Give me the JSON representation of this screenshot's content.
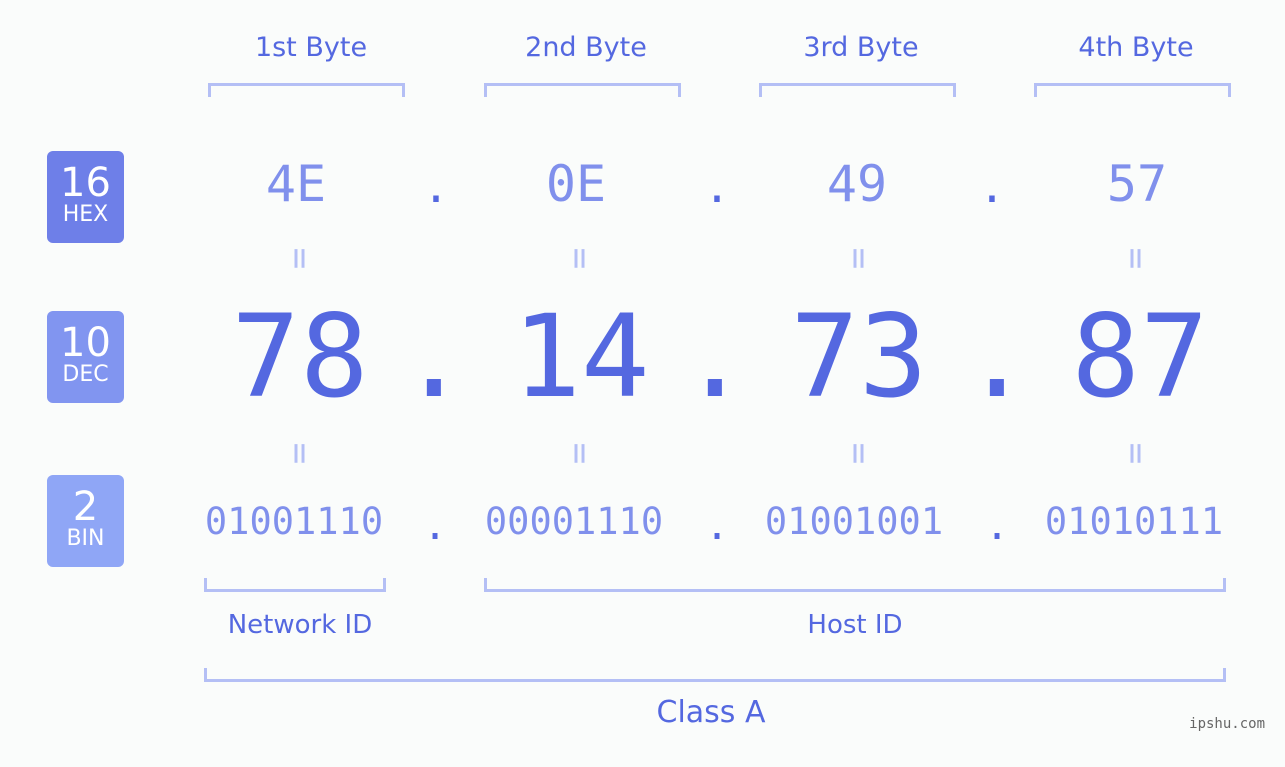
{
  "badges": [
    {
      "number": "16",
      "label": "HEX"
    },
    {
      "number": "10",
      "label": "DEC"
    },
    {
      "number": "2",
      "label": "BIN"
    }
  ],
  "byte_labels": [
    "1st Byte",
    "2nd Byte",
    "3rd Byte",
    "4th Byte"
  ],
  "hex": [
    "4E",
    "0E",
    "49",
    "57"
  ],
  "dec": [
    "78",
    "14",
    "73",
    "87"
  ],
  "bin": [
    "01001110",
    "00001110",
    "01001001",
    "01010111"
  ],
  "separator": ".",
  "equals": "=",
  "network_label": "Network ID",
  "host_label": "Host ID",
  "class_label": "Class A",
  "watermark": "ipshu.com",
  "colors": {
    "accent": "#5468e0",
    "light": "#8090ec",
    "bracket": "#b4bff5"
  }
}
